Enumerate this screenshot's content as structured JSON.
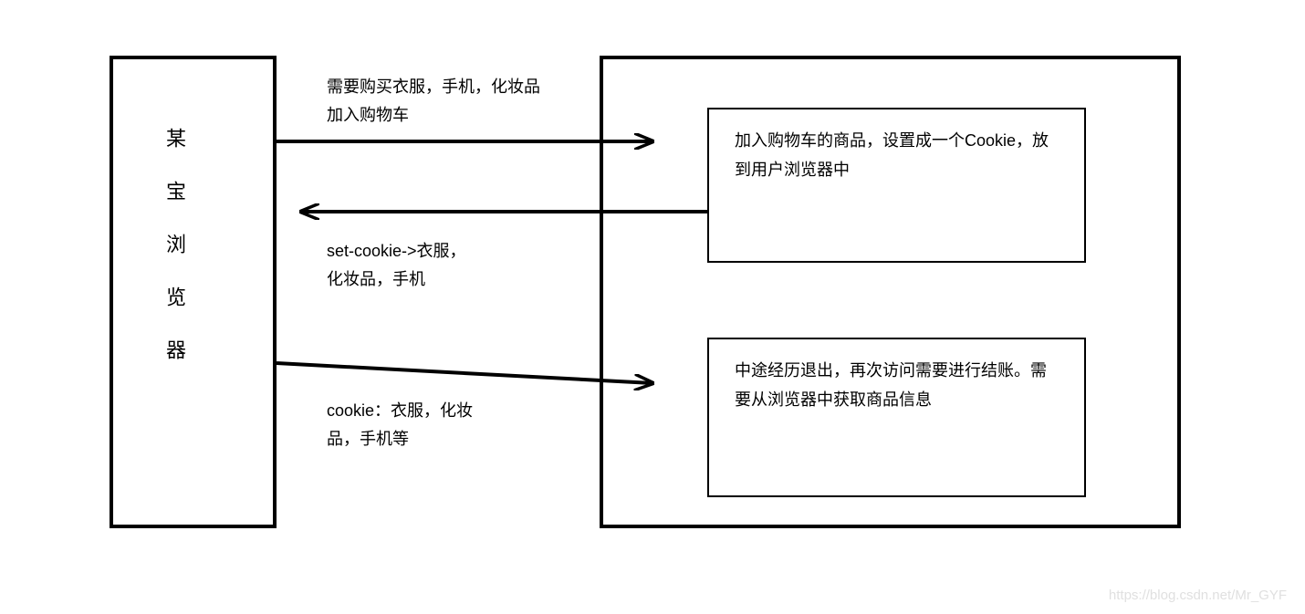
{
  "leftBox": {
    "label": "某宝浏览器"
  },
  "labels": {
    "top": "需要购买衣服，手机，化妆品\n加入购物车",
    "mid": "set-cookie->衣服，\n化妆品，手机",
    "bottom": "cookie：衣服，化妆\n品，手机等"
  },
  "innerBoxes": {
    "box1": "加入购物车的商品，设置成一个Cookie，放到用户浏览器中",
    "box2": "中途经历退出，再次访问需要进行结账。需要从浏览器中获取商品信息"
  },
  "watermark": "https://blog.csdn.net/Mr_GYF"
}
